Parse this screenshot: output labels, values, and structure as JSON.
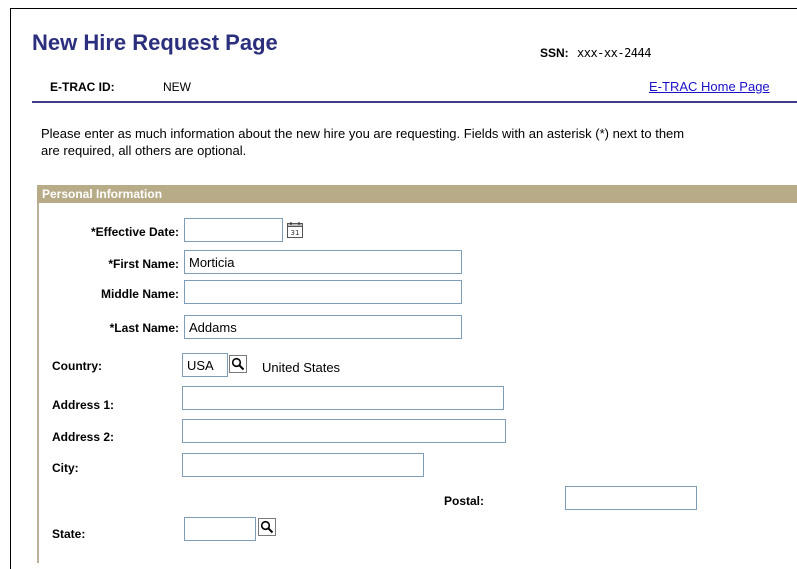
{
  "header": {
    "title": "New Hire Request Page",
    "ssn_label": "SSN:",
    "ssn_value": "xxx-xx-2444",
    "etrac_label": "E-TRAC ID:",
    "etrac_value": "NEW",
    "home_link": "E-TRAC Home Page"
  },
  "intro_text": "Please enter as much information about the new hire you are requesting. Fields with an asterisk (*) next to them are required, all others are optional.",
  "section": {
    "title": "Personal Information"
  },
  "fields": {
    "effective_date": {
      "label": "*Effective Date:",
      "value": ""
    },
    "first_name": {
      "label": "*First Name:",
      "value": "Morticia"
    },
    "middle_name": {
      "label": "Middle Name:",
      "value": ""
    },
    "last_name": {
      "label": "*Last Name:",
      "value": "Addams"
    },
    "country": {
      "label": "Country:",
      "value": "USA",
      "description": "United States"
    },
    "address1": {
      "label": "Address 1:",
      "value": ""
    },
    "address2": {
      "label": "Address 2:",
      "value": ""
    },
    "city": {
      "label": "City:",
      "value": ""
    },
    "postal": {
      "label": "Postal:",
      "value": ""
    },
    "state": {
      "label": "State:",
      "value": ""
    }
  },
  "icons": {
    "calendar": "calendar-icon",
    "lookup": "magnifier-icon"
  },
  "colors": {
    "title": "#2b2f7e",
    "section_header": "#b8ac88",
    "link": "#1a10c8",
    "divider": "#3c3c8a"
  }
}
